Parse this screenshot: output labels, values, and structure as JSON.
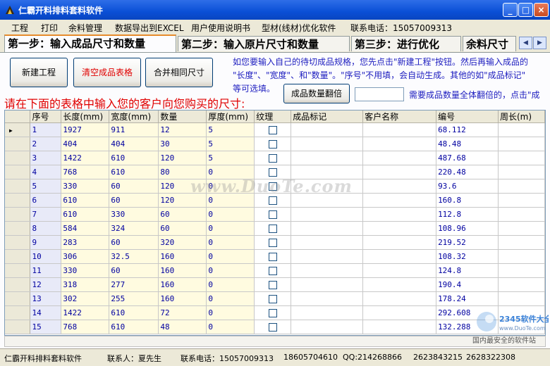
{
  "window": {
    "title": "仁霸开料排料套料软件",
    "title_color": "#0a4fd6"
  },
  "menu": {
    "items": [
      "工程",
      "打印",
      "余料管理",
      "数据导出到EXCEL",
      "用户使用说明书",
      "型材(线材)优化软件",
      "联系电话：15057009313"
    ]
  },
  "tabs": [
    {
      "label": "第一步：输入成品尺寸和数量",
      "active": true
    },
    {
      "label": "第二步：输入原片尺寸和数量",
      "active": false
    },
    {
      "label": "第三步：进行优化",
      "active": false
    },
    {
      "label": "余料尺寸",
      "active": false
    }
  ],
  "buttons": {
    "new_project": "新建工程",
    "clear_table": "清空成品表格",
    "merge_sizes": "合并相同尺寸",
    "multiply_qty": "成品数量翻倍"
  },
  "info_lines": [
    "如您要输入自己的待切成品规格，您先点击\"新建工程\"按钮。然后再输入成品的",
    "\"长度\"、\"宽度\"、和\"数量\"。\"序号\"不用填，会自动生成。其他的如\"成品标记\"",
    "等可选填。"
  ],
  "red_hint": "请在下面的表格中输入您的客户向您购买的尺寸:",
  "factor_hint": "需要成品数量全体翻倍的，点击\"成",
  "table": {
    "headers": [
      "序号",
      "长度(mm)",
      "宽度(mm)",
      "数量",
      "厚度(mm)",
      "纹理",
      "成品标记",
      "客户名称",
      "编号",
      "周长(m)"
    ],
    "rows": [
      [
        "1",
        "1927",
        "911",
        "12",
        "5",
        "68.112"
      ],
      [
        "2",
        "404",
        "404",
        "30",
        "5",
        "48.48"
      ],
      [
        "3",
        "1422",
        "610",
        "120",
        "5",
        "487.68"
      ],
      [
        "4",
        "768",
        "610",
        "80",
        "0",
        "220.48"
      ],
      [
        "5",
        "330",
        "60",
        "120",
        "0",
        "93.6"
      ],
      [
        "6",
        "610",
        "60",
        "120",
        "0",
        "160.8"
      ],
      [
        "7",
        "610",
        "330",
        "60",
        "0",
        "112.8"
      ],
      [
        "8",
        "584",
        "324",
        "60",
        "0",
        "108.96"
      ],
      [
        "9",
        "283",
        "60",
        "320",
        "0",
        "219.52"
      ],
      [
        "10",
        "306",
        "32.5",
        "160",
        "0",
        "108.32"
      ],
      [
        "11",
        "330",
        "60",
        "160",
        "0",
        "124.8"
      ],
      [
        "12",
        "318",
        "277",
        "160",
        "0",
        "190.4"
      ],
      [
        "13",
        "302",
        "255",
        "160",
        "0",
        "178.24"
      ],
      [
        "14",
        "1422",
        "610",
        "72",
        "0",
        "292.608"
      ],
      [
        "15",
        "768",
        "610",
        "48",
        "0",
        "132.288"
      ]
    ]
  },
  "status": {
    "app": "仁霸开料排料套料软件",
    "contact": "联系人：夏先生",
    "phone_label": "联系电话：15057009313",
    "phone2": "18605704610",
    "qq": "QQ:214268866",
    "qq2": "2623843215",
    "qq3": "2628322308"
  },
  "watermark": "www.DuoTe.com",
  "logo": {
    "brand": "2345软件大全",
    "url": "www.DuoTe.com",
    "slogan": "国内最安全的软件站"
  }
}
